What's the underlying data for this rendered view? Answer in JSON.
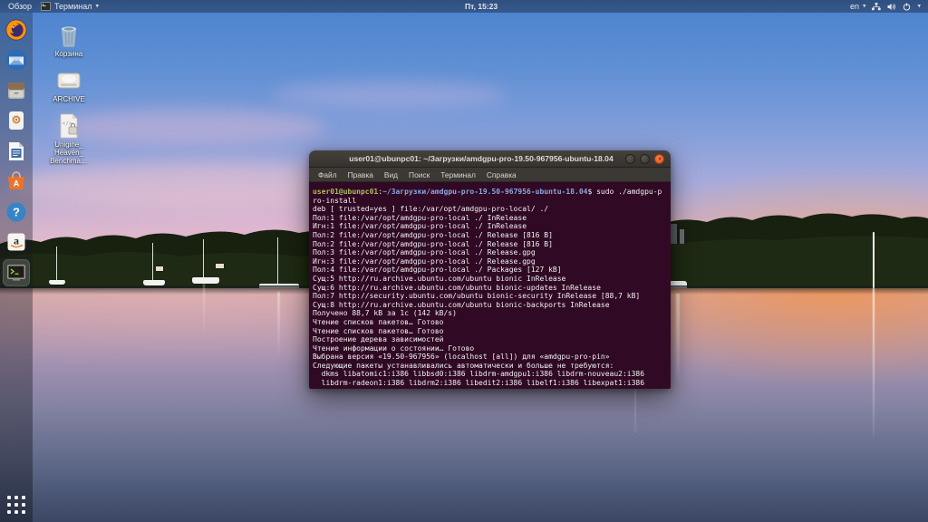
{
  "topbar": {
    "activities_label": "Обзор",
    "focused_app_label": "Терминал",
    "clock": "Пт, 15:23",
    "keyboard_layout": "en",
    "chevron": "▾",
    "tray_icons": [
      "network-wired-icon",
      "volume-icon",
      "power-icon"
    ]
  },
  "desktop": {
    "icons": [
      {
        "name": "trash",
        "label": "Корзина"
      },
      {
        "name": "archive-drive",
        "label": "ARCHIVE"
      },
      {
        "name": "unigine-file",
        "label_lines": [
          "Unigine_",
          "Heaven_",
          "Benchma…"
        ]
      }
    ]
  },
  "dock": {
    "icons": [
      "firefox-icon",
      "thunderbird-icon",
      "files-icon",
      "rhythmbox-icon",
      "libreoffice-writer-icon",
      "ubuntu-software-icon",
      "help-icon",
      "amazon-icon",
      "terminal-icon",
      "show-applications-icon"
    ],
    "running_app": "terminal"
  },
  "terminal_window": {
    "title": "user01@ubunpc01: ~/Загрузки/amdgpu-pro-19.50-967956-ubuntu-18.04",
    "menu": [
      "Файл",
      "Правка",
      "Вид",
      "Поиск",
      "Терминал",
      "Справка"
    ],
    "lines": [
      {
        "segments": [
          {
            "text": "user01@ubunpc01",
            "cls": "seg-green"
          },
          {
            "text": ":",
            "cls": "seg-fg"
          },
          {
            "text": "~/Загрузки/amdgpu-pro-19.50-967956-ubuntu-18.04",
            "cls": "seg-blue"
          },
          {
            "text": "$ sudo ./amdgpu-p",
            "cls": "seg-fg"
          }
        ]
      },
      {
        "text": "ro-install"
      },
      {
        "text": "deb [ trusted=yes ] file:/var/opt/amdgpu-pro-local/ ./"
      },
      {
        "text": "Пол:1 file:/var/opt/amdgpu-pro-local ./ InRelease"
      },
      {
        "text": "Игн:1 file:/var/opt/amdgpu-pro-local ./ InRelease"
      },
      {
        "text": "Пол:2 file:/var/opt/amdgpu-pro-local ./ Release [816 B]"
      },
      {
        "text": "Пол:2 file:/var/opt/amdgpu-pro-local ./ Release [816 B]"
      },
      {
        "text": "Пол:3 file:/var/opt/amdgpu-pro-local ./ Release.gpg"
      },
      {
        "text": "Игн:3 file:/var/opt/amdgpu-pro-local ./ Release.gpg"
      },
      {
        "text": "Пол:4 file:/var/opt/amdgpu-pro-local ./ Packages [127 kB]"
      },
      {
        "text": "Сущ:5 http://ru.archive.ubuntu.com/ubuntu bionic InRelease"
      },
      {
        "text": "Сущ:6 http://ru.archive.ubuntu.com/ubuntu bionic-updates InRelease"
      },
      {
        "text": "Пол:7 http://security.ubuntu.com/ubuntu bionic-security InRelease [88,7 kB]"
      },
      {
        "text": "Сущ:8 http://ru.archive.ubuntu.com/ubuntu bionic-backports InRelease"
      },
      {
        "text": "Получено 88,7 kB за 1с (142 kB/s)"
      },
      {
        "text": "Чтение списков пакетов… Готово"
      },
      {
        "text": "Чтение списков пакетов… Готово"
      },
      {
        "text": "Построение дерева зависимостей"
      },
      {
        "text": "Чтение информации о состоянии… Готово"
      },
      {
        "text": "Выбрана версия «19.50-967956» (localhost [all]) для «amdgpu-pro-pin»"
      },
      {
        "text": "Следующие пакеты устанавливались автоматически и больше не требуются:"
      },
      {
        "text": "  dkms libatomic1:i386 libbsd0:i386 libdrm-amdgpu1:i386 libdrm-nouveau2:i386"
      },
      {
        "text": "  libdrm-radeon1:i386 libdrm2:i386 libedit2:i386 libelf1:i386 libexpat1:i386"
      }
    ]
  },
  "colors": {
    "accent_orange": "#e95420",
    "terminal_bg": "#300a24",
    "terminal_fg": "#f2f1ef",
    "prompt_user": "#a8bf5a",
    "prompt_path": "#8da5dd",
    "topbar_text": "#e6e9ee"
  }
}
